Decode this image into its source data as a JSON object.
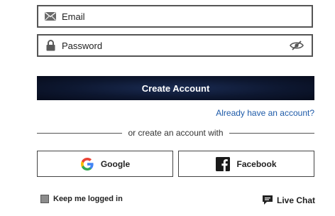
{
  "email_field": {
    "placeholder": "Email",
    "icon": "envelope-icon"
  },
  "password_field": {
    "placeholder": "Password",
    "icon": "lock-icon",
    "toggle_icon": "eye-slash-icon"
  },
  "create_account": {
    "label": "Create Account"
  },
  "signin_link": {
    "label": "Already have an account?",
    "color": "#1d5aa8"
  },
  "divider": {
    "label": "or create an account with"
  },
  "social": {
    "google": {
      "label": "Google",
      "icon": "google-icon"
    },
    "facebook": {
      "label": "Facebook",
      "icon": "facebook-icon"
    }
  },
  "keep_logged_in": {
    "label": "Keep me logged in",
    "checked": false
  },
  "live_chat": {
    "label": "Live Chat",
    "icon": "chat-bubble-icon"
  },
  "colors": {
    "button_dark": "#0d1730",
    "link": "#1d5aa8",
    "border": "#555555"
  }
}
